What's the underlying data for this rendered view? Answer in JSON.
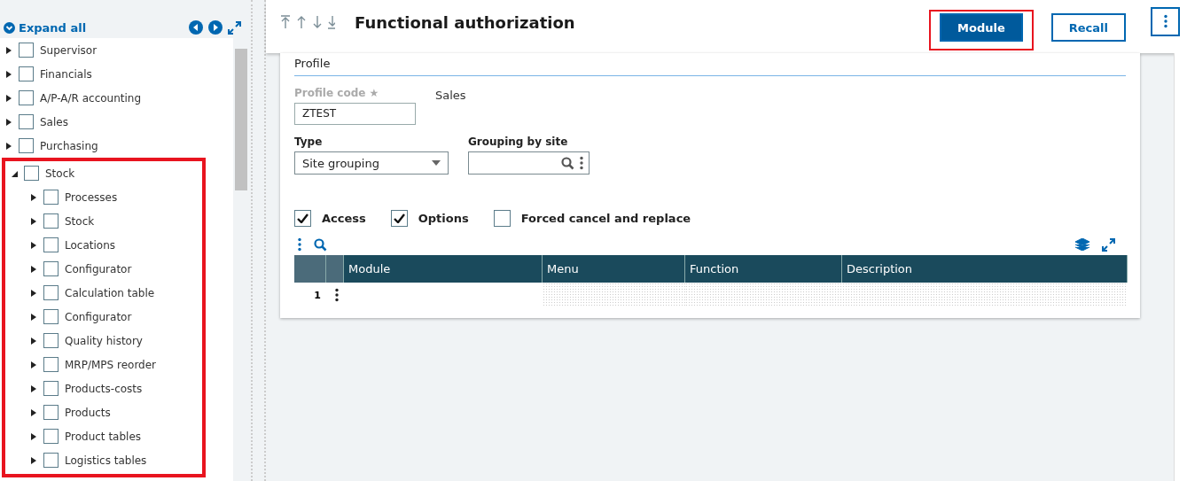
{
  "sidebar": {
    "expand_all": "Expand all",
    "tree": [
      {
        "label": "Supervisor",
        "checked": false,
        "expanded": false,
        "highlighted": false
      },
      {
        "label": "Financials",
        "checked": false,
        "expanded": false,
        "highlighted": false
      },
      {
        "label": "A/P-A/R accounting",
        "checked": false,
        "expanded": false,
        "highlighted": false
      },
      {
        "label": "Sales",
        "checked": false,
        "expanded": false,
        "highlighted": false
      },
      {
        "label": "Purchasing",
        "checked": false,
        "expanded": false,
        "highlighted": false
      },
      {
        "label": "Stock",
        "checked": false,
        "expanded": true,
        "highlighted": true,
        "children": [
          {
            "label": "Processes",
            "checked": false,
            "expanded": false
          },
          {
            "label": "Stock",
            "checked": false,
            "expanded": false
          },
          {
            "label": "Locations",
            "checked": false,
            "expanded": false
          },
          {
            "label": "Configurator",
            "checked": false,
            "expanded": false
          },
          {
            "label": "Calculation table",
            "checked": false,
            "expanded": false
          },
          {
            "label": "Configurator",
            "checked": false,
            "expanded": false
          },
          {
            "label": "Quality history",
            "checked": false,
            "expanded": false
          },
          {
            "label": "MRP/MPS reorder",
            "checked": false,
            "expanded": false
          },
          {
            "label": "Products-costs",
            "checked": false,
            "expanded": false
          },
          {
            "label": "Products",
            "checked": false,
            "expanded": false
          },
          {
            "label": "Product tables",
            "checked": false,
            "expanded": false
          },
          {
            "label": "Logistics tables",
            "checked": false,
            "expanded": false
          }
        ]
      }
    ]
  },
  "header": {
    "title": "Functional authorization",
    "buttons": [
      {
        "label": "Module",
        "kind": "primary",
        "highlighted": true
      },
      {
        "label": "Recall",
        "kind": "outline",
        "highlighted": false
      }
    ]
  },
  "form": {
    "section": "Profile",
    "profile_code": {
      "label": "Profile code",
      "required_mark": "★",
      "value": "ZTEST",
      "description": "Sales"
    },
    "type": {
      "label": "Type",
      "value": "Site grouping"
    },
    "grouping_by_site": {
      "label": "Grouping by site"
    },
    "checkboxes": [
      {
        "label": "Access",
        "checked": true
      },
      {
        "label": "Options",
        "checked": true
      },
      {
        "label": "Forced cancel and replace",
        "checked": false
      }
    ],
    "table": {
      "columns": [
        "Module",
        "Menu",
        "Function",
        "Description"
      ],
      "rows": [
        {
          "number": "1"
        }
      ]
    }
  }
}
